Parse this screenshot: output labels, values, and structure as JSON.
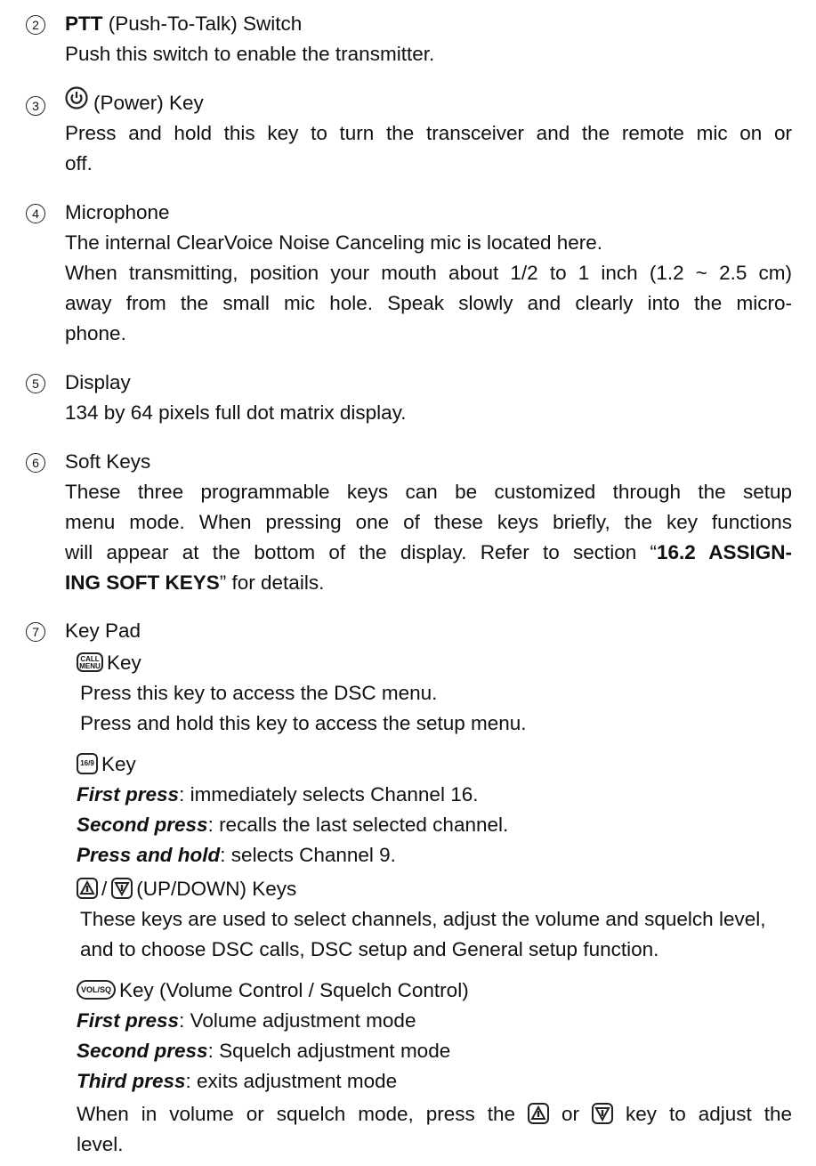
{
  "items": [
    {
      "num": "2",
      "title_bold": "PTT",
      "title_rest": " (Push-To-Talk) Switch",
      "desc": "Push this switch to enable the transmitter."
    },
    {
      "num": "3",
      "title": "(Power) Key",
      "desc_l1": "Press and hold this key to turn the transceiver and the remote mic on or",
      "desc_l2": "off."
    },
    {
      "num": "4",
      "title": "Microphone",
      "desc_l1": "The internal ClearVoice Noise Canceling mic is located here.",
      "desc_l2": "When transmitting, position your mouth about 1/2 to 1 inch (1.2 ~ 2.5 cm)",
      "desc_l3": "away from the small mic hole. Speak slowly and clearly into the micro-",
      "desc_l4": "phone."
    },
    {
      "num": "5",
      "title": "Display",
      "desc": "134 by 64 pixels full dot matrix display."
    },
    {
      "num": "6",
      "title": "Soft Keys",
      "desc_l1": "These three programmable keys can be customized through the setup",
      "desc_l2": "menu mode. When pressing one of these keys briefly, the key functions",
      "desc_l3a": "will appear at the bottom of the display. Refer to section “",
      "desc_l3b": "16.2 ASSIGN-",
      "desc_l4a": "ING SOFT KEYS",
      "desc_l4b": "” for details."
    },
    {
      "num": "7",
      "title": "Key Pad"
    }
  ],
  "keypad": {
    "call_key": {
      "icon_top": "CALL",
      "icon_bottom": "MENU",
      "label": "Key",
      "lines": [
        "Press this key to access the DSC menu.",
        "Press and hold this key to access the setup menu."
      ]
    },
    "ch169_key": {
      "icon": "16/9",
      "label": "Key",
      "first_label": "First press",
      "first_text": ": immediately selects Channel 16.",
      "second_label": "Second press",
      "second_text": ": recalls the last selected channel.",
      "hold_label": "Press and hold",
      "hold_text": ": selects Channel 9."
    },
    "updown_key": {
      "sep": "/",
      "label": "(UP/DOWN) Keys",
      "desc_l1": "These keys are used to select channels, adjust the volume and",
      "desc_l2": "squelch level, and to choose DSC calls, DSC setup and General setup",
      "desc_l3": "function."
    },
    "volsq_key": {
      "icon": "VOL/SQ",
      "label": "Key (Volume Control / Squelch Control)",
      "first_label": "First press",
      "first_text": ": Volume adjustment mode",
      "second_label": "Second press",
      "second_text": ": Squelch adjustment mode",
      "third_label": "Third press",
      "third_text": ": exits adjustment mode",
      "note_a": "When in volume or squelch mode, press the",
      "note_or": "or",
      "note_b": "key to adjust the",
      "note_l2": "level."
    }
  },
  "icons": [
    "power-icon",
    "call-menu-key-icon",
    "ch16-9-key-icon",
    "up-arrow-key-icon",
    "down-arrow-key-icon",
    "vol-sq-key-icon"
  ]
}
